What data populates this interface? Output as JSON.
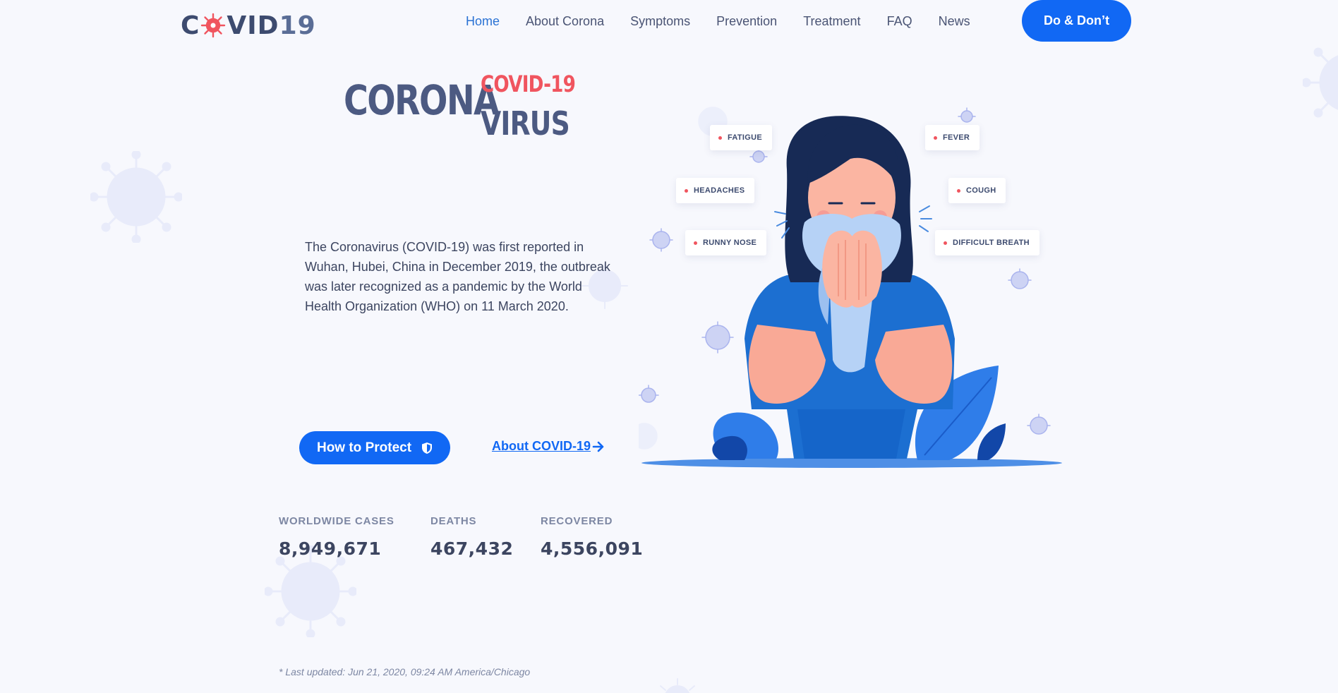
{
  "header": {
    "logo_left": "C",
    "logo_right": "VID",
    "logo_num": "19",
    "nav": [
      {
        "label": "Home",
        "active": true
      },
      {
        "label": "About Corona",
        "active": false
      },
      {
        "label": "Symptoms",
        "active": false
      },
      {
        "label": "Prevention",
        "active": false
      },
      {
        "label": "Treatment",
        "active": false
      },
      {
        "label": "FAQ",
        "active": false
      },
      {
        "label": "News",
        "active": false
      }
    ],
    "cta_label": "Do & Don’t"
  },
  "hero": {
    "title_main": "CORONA",
    "title_accent": "COVID-19",
    "title_sub": "VIRUS",
    "intro": "The Coronavirus (COVID-19) was first reported in Wuhan, Hubei, China in December 2019, the outbreak was later recognized as a pandemic by the World Health Organization (WHO) on 11 March 2020.",
    "protect_button": "How to Protect",
    "protect_icon": "shield-icon",
    "about_link": "About COVID-19",
    "about_icon": "arrow-right-icon"
  },
  "symptoms": [
    "FATIGUE",
    "FEVER",
    "HEADACHES",
    "COUGH",
    "RUNNY NOSE",
    "DIFFICULT BREATH"
  ],
  "stats": [
    {
      "label": "WORLDWIDE CASES",
      "value": "8,949,671"
    },
    {
      "label": "DEATHS",
      "value": "467,432"
    },
    {
      "label": "RECOVERED",
      "value": "4,556,091"
    }
  ],
  "updated": "* Last updated: Jun 21, 2020, 09:24 AM America/Chicago",
  "colors": {
    "primary": "#1168f4",
    "accent_red": "#f0555f",
    "heading": "#4c5a82",
    "background": "#f7f8fd"
  }
}
